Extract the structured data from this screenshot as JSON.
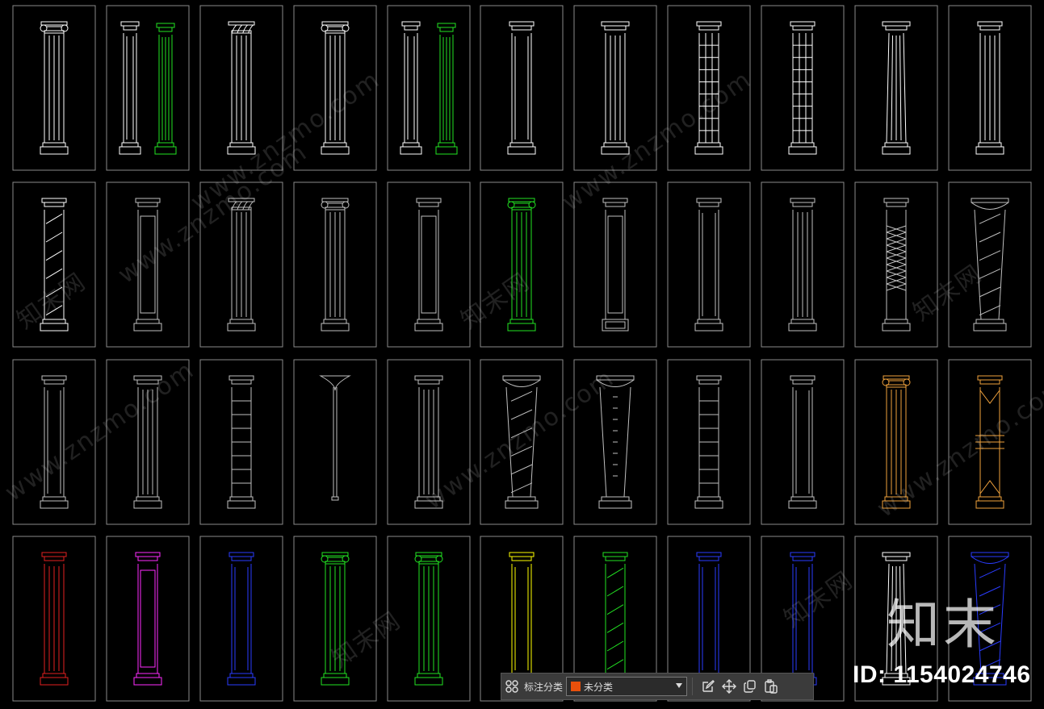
{
  "viewport": {
    "title": ""
  },
  "watermark": {
    "site_text": "www.znzmo.com",
    "cn_text": "知末网"
  },
  "logo": {
    "text": "知末",
    "id_label": "ID: 1154024746"
  },
  "toolbar": {
    "label": "标注分类",
    "selected_category": "未分类",
    "swatch_color": "#e8500c",
    "icons": [
      "grid-icon",
      "edit-icon",
      "move-icon",
      "copy-icon",
      "paste-icon"
    ]
  },
  "colors": {
    "frame": "#8a8a8a",
    "white": "#ffffff",
    "green": "#22e322",
    "orange": "#f0a23c",
    "red": "#e31f1f",
    "magenta": "#ff2bff",
    "yellow": "#ffff00",
    "blue": "#2a3cff",
    "cyan": "#00ffff",
    "gray": "#bfbfbf"
  },
  "columns": [
    {
      "row": 0,
      "col": 0,
      "style": "ionic",
      "color": "white"
    },
    {
      "row": 0,
      "col": 1,
      "style": "pair",
      "color": "white",
      "second": "green"
    },
    {
      "row": 0,
      "col": 2,
      "style": "corinthian",
      "color": "white"
    },
    {
      "row": 0,
      "col": 3,
      "style": "ionic",
      "color": "white"
    },
    {
      "row": 0,
      "col": 4,
      "style": "pair",
      "color": "white",
      "second": "green"
    },
    {
      "row": 0,
      "col": 5,
      "style": "plain",
      "color": "white"
    },
    {
      "row": 0,
      "col": 6,
      "style": "tuscan",
      "color": "white"
    },
    {
      "row": 0,
      "col": 7,
      "style": "grid",
      "color": "white"
    },
    {
      "row": 0,
      "col": 8,
      "style": "grid",
      "color": "white"
    },
    {
      "row": 0,
      "col": 9,
      "style": "tapered",
      "color": "white"
    },
    {
      "row": 0,
      "col": 10,
      "style": "fluted",
      "color": "white"
    },
    {
      "row": 1,
      "col": 0,
      "style": "twisted",
      "color": "white"
    },
    {
      "row": 1,
      "col": 1,
      "style": "pilaster",
      "color": "gray"
    },
    {
      "row": 1,
      "col": 2,
      "style": "corinthian",
      "color": "gray"
    },
    {
      "row": 1,
      "col": 3,
      "style": "ionic",
      "color": "gray"
    },
    {
      "row": 1,
      "col": 4,
      "style": "pilaster",
      "color": "gray"
    },
    {
      "row": 1,
      "col": 5,
      "style": "ionic",
      "color": "green"
    },
    {
      "row": 1,
      "col": 6,
      "style": "pedestal",
      "color": "gray"
    },
    {
      "row": 1,
      "col": 7,
      "style": "plain",
      "color": "gray"
    },
    {
      "row": 1,
      "col": 8,
      "style": "fluted",
      "color": "gray"
    },
    {
      "row": 1,
      "col": 9,
      "style": "lattice",
      "color": "gray"
    },
    {
      "row": 1,
      "col": 10,
      "style": "spiral",
      "color": "gray"
    },
    {
      "row": 2,
      "col": 0,
      "style": "plain",
      "color": "gray"
    },
    {
      "row": 2,
      "col": 1,
      "style": "tuscan",
      "color": "gray"
    },
    {
      "row": 2,
      "col": 2,
      "style": "banded",
      "color": "gray"
    },
    {
      "row": 2,
      "col": 3,
      "style": "lamp",
      "color": "gray"
    },
    {
      "row": 2,
      "col": 4,
      "style": "tuscan",
      "color": "gray"
    },
    {
      "row": 2,
      "col": 5,
      "style": "spiral",
      "color": "gray"
    },
    {
      "row": 2,
      "col": 6,
      "style": "vase",
      "color": "gray"
    },
    {
      "row": 2,
      "col": 7,
      "style": "banded",
      "color": "gray"
    },
    {
      "row": 2,
      "col": 8,
      "style": "plain",
      "color": "gray"
    },
    {
      "row": 2,
      "col": 9,
      "style": "ionic",
      "color": "orange"
    },
    {
      "row": 2,
      "col": 10,
      "style": "deco",
      "color": "orange"
    },
    {
      "row": 3,
      "col": 0,
      "style": "fluted",
      "color": "red"
    },
    {
      "row": 3,
      "col": 1,
      "style": "pilaster",
      "color": "magenta"
    },
    {
      "row": 3,
      "col": 2,
      "style": "plain",
      "color": "blue"
    },
    {
      "row": 3,
      "col": 3,
      "style": "ionic",
      "color": "green"
    },
    {
      "row": 3,
      "col": 4,
      "style": "ionic",
      "color": "green"
    },
    {
      "row": 3,
      "col": 5,
      "style": "plain",
      "color": "yellow"
    },
    {
      "row": 3,
      "col": 6,
      "style": "twisted",
      "color": "green"
    },
    {
      "row": 3,
      "col": 7,
      "style": "plain",
      "color": "blue"
    },
    {
      "row": 3,
      "col": 8,
      "style": "plain",
      "color": "blue"
    },
    {
      "row": 3,
      "col": 9,
      "style": "tapered",
      "color": "white"
    },
    {
      "row": 3,
      "col": 10,
      "style": "spiral",
      "color": "blue"
    }
  ]
}
